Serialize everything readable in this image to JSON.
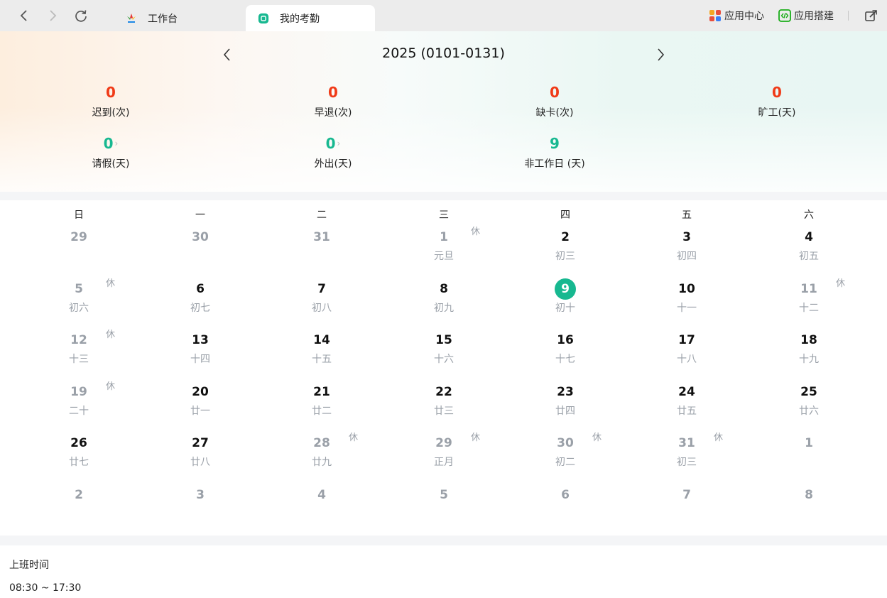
{
  "browser": {
    "tabs": [
      {
        "label": "工作台",
        "icon": "app-logo-icon"
      },
      {
        "label": "我的考勤",
        "icon": "attendance-icon"
      }
    ],
    "tools": {
      "app_center": "应用中心",
      "app_builder": "应用搭建"
    }
  },
  "header": {
    "title": "2025 (0101-0131)",
    "stats_row1": [
      {
        "value": "0",
        "label": "迟到(次)",
        "color": "#f03a17"
      },
      {
        "value": "0",
        "label": "早退(次)",
        "color": "#f03a17"
      },
      {
        "value": "0",
        "label": "缺卡(次)",
        "color": "#f03a17"
      },
      {
        "value": "0",
        "label": "旷工(天)",
        "color": "#f03a17"
      }
    ],
    "stats_row2": [
      {
        "value": "0",
        "label": "请假(天)",
        "color": "#17b890"
      },
      {
        "value": "0",
        "label": "外出(天)",
        "color": "#17b890"
      },
      {
        "value": "9",
        "label": "非工作日 (天)",
        "color": "#17b890"
      }
    ]
  },
  "calendar": {
    "weekdays": [
      "日",
      "一",
      "二",
      "三",
      "四",
      "五",
      "六"
    ],
    "rest_label": "休",
    "weeks": [
      [
        {
          "num": "29",
          "lunar": "",
          "grey": true
        },
        {
          "num": "30",
          "lunar": "",
          "grey": true
        },
        {
          "num": "31",
          "lunar": "",
          "grey": true
        },
        {
          "num": "1",
          "lunar": "元旦",
          "grey": true,
          "rest": true
        },
        {
          "num": "2",
          "lunar": "初三"
        },
        {
          "num": "3",
          "lunar": "初四"
        },
        {
          "num": "4",
          "lunar": "初五"
        }
      ],
      [
        {
          "num": "5",
          "lunar": "初六",
          "grey": true,
          "rest": true
        },
        {
          "num": "6",
          "lunar": "初七"
        },
        {
          "num": "7",
          "lunar": "初八"
        },
        {
          "num": "8",
          "lunar": "初九"
        },
        {
          "num": "9",
          "lunar": "初十",
          "today": true
        },
        {
          "num": "10",
          "lunar": "十一"
        },
        {
          "num": "11",
          "lunar": "十二",
          "grey": true,
          "rest": true
        }
      ],
      [
        {
          "num": "12",
          "lunar": "十三",
          "grey": true,
          "rest": true
        },
        {
          "num": "13",
          "lunar": "十四"
        },
        {
          "num": "14",
          "lunar": "十五"
        },
        {
          "num": "15",
          "lunar": "十六"
        },
        {
          "num": "16",
          "lunar": "十七"
        },
        {
          "num": "17",
          "lunar": "十八"
        },
        {
          "num": "18",
          "lunar": "十九"
        }
      ],
      [
        {
          "num": "19",
          "lunar": "二十",
          "grey": true,
          "rest": true
        },
        {
          "num": "20",
          "lunar": "廿一"
        },
        {
          "num": "21",
          "lunar": "廿二"
        },
        {
          "num": "22",
          "lunar": "廿三"
        },
        {
          "num": "23",
          "lunar": "廿四"
        },
        {
          "num": "24",
          "lunar": "廿五"
        },
        {
          "num": "25",
          "lunar": "廿六"
        }
      ],
      [
        {
          "num": "26",
          "lunar": "廿七"
        },
        {
          "num": "27",
          "lunar": "廿八"
        },
        {
          "num": "28",
          "lunar": "廿九",
          "grey": true,
          "rest": true
        },
        {
          "num": "29",
          "lunar": "正月",
          "grey": true,
          "rest": true
        },
        {
          "num": "30",
          "lunar": "初二",
          "grey": true,
          "rest": true
        },
        {
          "num": "31",
          "lunar": "初三",
          "grey": true,
          "rest": true
        },
        {
          "num": "1",
          "lunar": "",
          "grey": true
        }
      ],
      [
        {
          "num": "2",
          "lunar": "",
          "grey": true
        },
        {
          "num": "3",
          "lunar": "",
          "grey": true
        },
        {
          "num": "4",
          "lunar": "",
          "grey": true
        },
        {
          "num": "5",
          "lunar": "",
          "grey": true
        },
        {
          "num": "6",
          "lunar": "",
          "grey": true
        },
        {
          "num": "7",
          "lunar": "",
          "grey": true
        },
        {
          "num": "8",
          "lunar": "",
          "grey": true
        }
      ]
    ]
  },
  "work_time": {
    "title": "上班时间",
    "value": "08:30 ~ 17:30"
  }
}
